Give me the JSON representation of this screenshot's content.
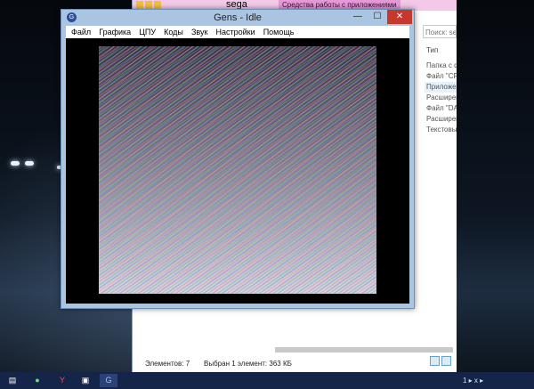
{
  "explorer": {
    "title": "sega",
    "badge": "Средства работы с приложениями",
    "search_placeholder": "Поиск: se...",
    "column_header": "Тип",
    "types": [
      "Папка с ф",
      "Файл \"CF",
      "Приложе",
      "Расширен",
      "Файл \"DA",
      "Расширен",
      "Текстовы"
    ],
    "selected_index": 2,
    "status_count": "Элементов: 7",
    "status_selected": "Выбран 1 элемент: 363 КБ"
  },
  "gens": {
    "title": "Gens - Idle",
    "menu": [
      "Файл",
      "Графика",
      "ЦПУ",
      "Коды",
      "Звук",
      "Настройки",
      "Помощь"
    ]
  },
  "taskbar": {
    "tray_text": "1 ▸ x ▸"
  },
  "colors": {
    "gens_frame": "#a9c5e2",
    "close_button": "#c7382c",
    "taskbar": "#15254a",
    "explorer_titlebar": "#f3c8e8",
    "explorer_badge": "#e49ad8"
  }
}
